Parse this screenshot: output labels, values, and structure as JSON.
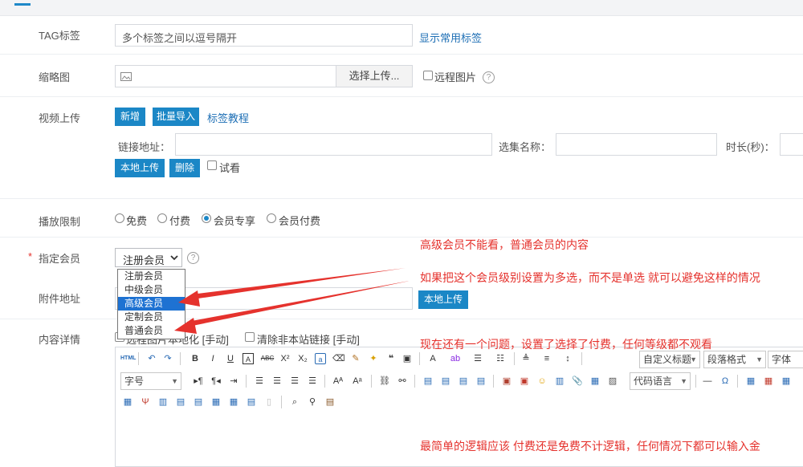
{
  "tag": {
    "label": "TAG标签",
    "placeholder": "多个标签之间以逗号隔开",
    "link": "显示常用标签"
  },
  "thumb": {
    "label": "缩略图",
    "upload_button": "选择上传...",
    "remote_label": "远程图片",
    "help": "?"
  },
  "video": {
    "label": "视频上传",
    "add_button": "新增",
    "bulk_button": "批量导入",
    "tutorial_link": "标签教程",
    "link_label": "链接地址：",
    "episode_label": "选集名称：",
    "duration_label": "时长(秒)：",
    "local_upload_button": "本地上传",
    "delete_button": "删除",
    "trial_label": "试看"
  },
  "playback": {
    "label": "播放限制",
    "options": [
      "免费",
      "付费",
      "会员专享",
      "会员付费"
    ],
    "selected": 2
  },
  "member": {
    "required_mark": "*",
    "label": "指定会员",
    "selected_value": "注册会员",
    "help": "?",
    "options": [
      "注册会员",
      "中级会员",
      "高级会员",
      "定制会员",
      "普通会员"
    ],
    "highlighted": 2
  },
  "attachment": {
    "label": "附件地址",
    "upload_button": "本地上传"
  },
  "content": {
    "label": "内容详情",
    "localize_text": "远程图片本地化 [手动]",
    "clear_links_label": "清除非本站链接 [手动]"
  },
  "toolbar": {
    "html": "HTML",
    "custom_title": "自定义标题",
    "paragraph": "段落格式",
    "font_family": "字体",
    "font_size": "字号",
    "code_lang": "代码语言"
  },
  "annotations": {
    "note1": "高级会员不能看，普通会员的内容",
    "note2": "如果把这个会员级别设置为多选，而不是单选 就可以避免这样的情况",
    "note3": "现在还有一个问题，设置了选择了付费，任何等级都不观看",
    "note4": "最简单的逻辑应该 付费还是免费不计逻辑，任何情况下都可以输入金"
  },
  "colors": {
    "primary": "#1b87c6",
    "annotation": "#e5322d",
    "highlight": "#1e72d2"
  }
}
